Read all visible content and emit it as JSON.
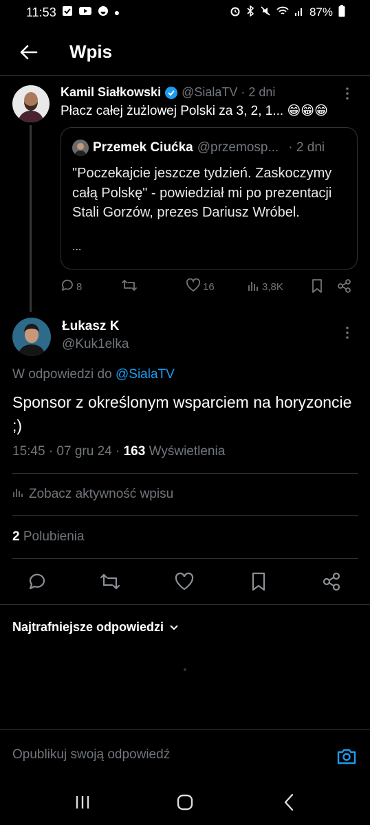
{
  "status_bar": {
    "time": "11:53",
    "battery": "87%",
    "left_icons": [
      "check-box-icon",
      "youtube-icon",
      "app-icon",
      "dot-icon"
    ],
    "right_icons": [
      "alarm-icon",
      "bluetooth-icon",
      "mute-icon",
      "wifi-icon",
      "signal-icon",
      "battery-icon"
    ]
  },
  "header": {
    "title": "Wpis"
  },
  "parent_tweet": {
    "name": "Kamil Siałkowski",
    "handle": "@SialaTV",
    "time": "· 2 dni",
    "text": "Płacz całej żużlowej Polski za 3, 2, 1... 😁😁😁",
    "quote": {
      "name": "Przemek Ciućka",
      "handle": "@przemosp...",
      "time": "· 2 dni",
      "text": "\"Poczekajcie jeszcze tydzień. Zaskoczymy całą Polskę\" - powiedział mi po prezentacji Stali Gorzów, prezes Dariusz Wróbel.",
      "ellipsis": "..."
    },
    "replies": "8",
    "retweets": "",
    "likes": "16",
    "views": "3,8K"
  },
  "main_tweet": {
    "name": "Łukasz K",
    "handle": "@Kuk1elka",
    "replying_prefix": "W odpowiedzi do",
    "replying_to": "@SialaTV",
    "text": "Sponsor z określonym wsparciem na horyzoncie  ;)",
    "time": "15:45 · 07 gru 24 ·",
    "views_count": "163",
    "views_label": "Wyświetlenia",
    "activity_label": "Zobacz aktywność wpisu",
    "likes_count": "2",
    "likes_label": "Polubienia"
  },
  "replies_sort": {
    "label": "Najtrafniejsze odpowiedzi"
  },
  "reply_box": {
    "placeholder": "Opublikuj swoją odpowiedź"
  },
  "colors": {
    "accent": "#1d9bf0",
    "background": "#000000",
    "muted": "#71767b",
    "divider": "#2f3336"
  }
}
